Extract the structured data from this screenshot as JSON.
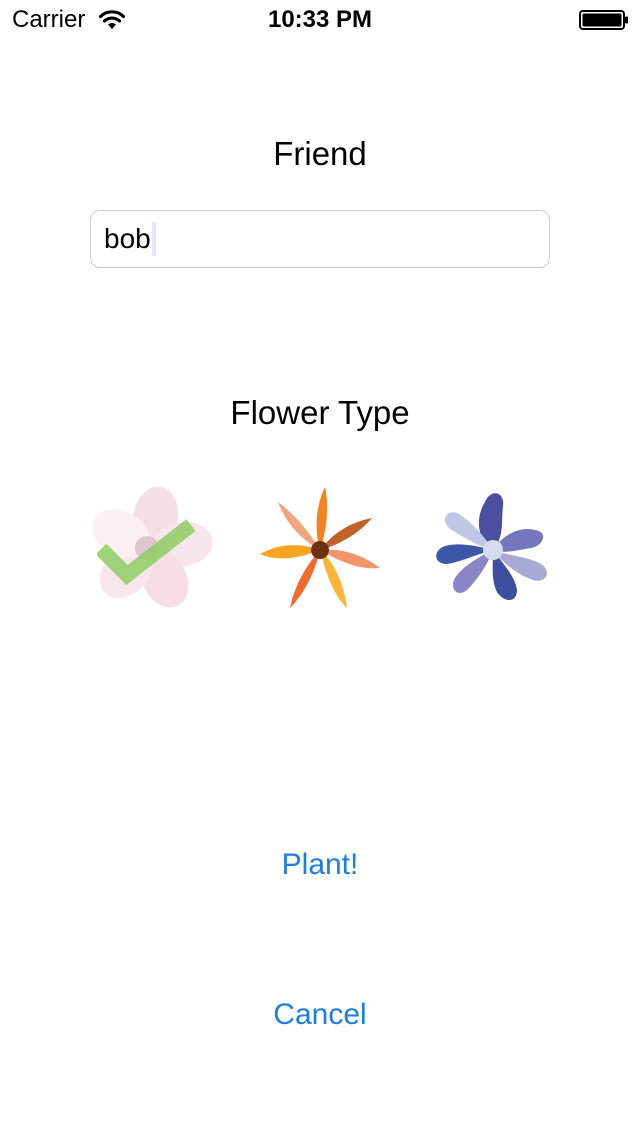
{
  "status_bar": {
    "carrier": "Carrier",
    "time": "10:33 PM",
    "wifi_icon": "wifi-icon",
    "battery_icon": "battery-icon"
  },
  "form": {
    "friend_label": "Friend",
    "friend_value": "bob",
    "flower_type_label": "Flower Type"
  },
  "flowers": [
    {
      "name": "pink-flower",
      "selected": true
    },
    {
      "name": "orange-flower",
      "selected": false
    },
    {
      "name": "blue-flower",
      "selected": false
    }
  ],
  "buttons": {
    "plant": "Plant!",
    "cancel": "Cancel"
  },
  "colors": {
    "accent": "#1a7ee6",
    "checkmark": "#8fcc63",
    "pink_petal": "#f7dbe6",
    "orange_petal": "#f08a24",
    "blue_petal": "#4b56a8"
  }
}
